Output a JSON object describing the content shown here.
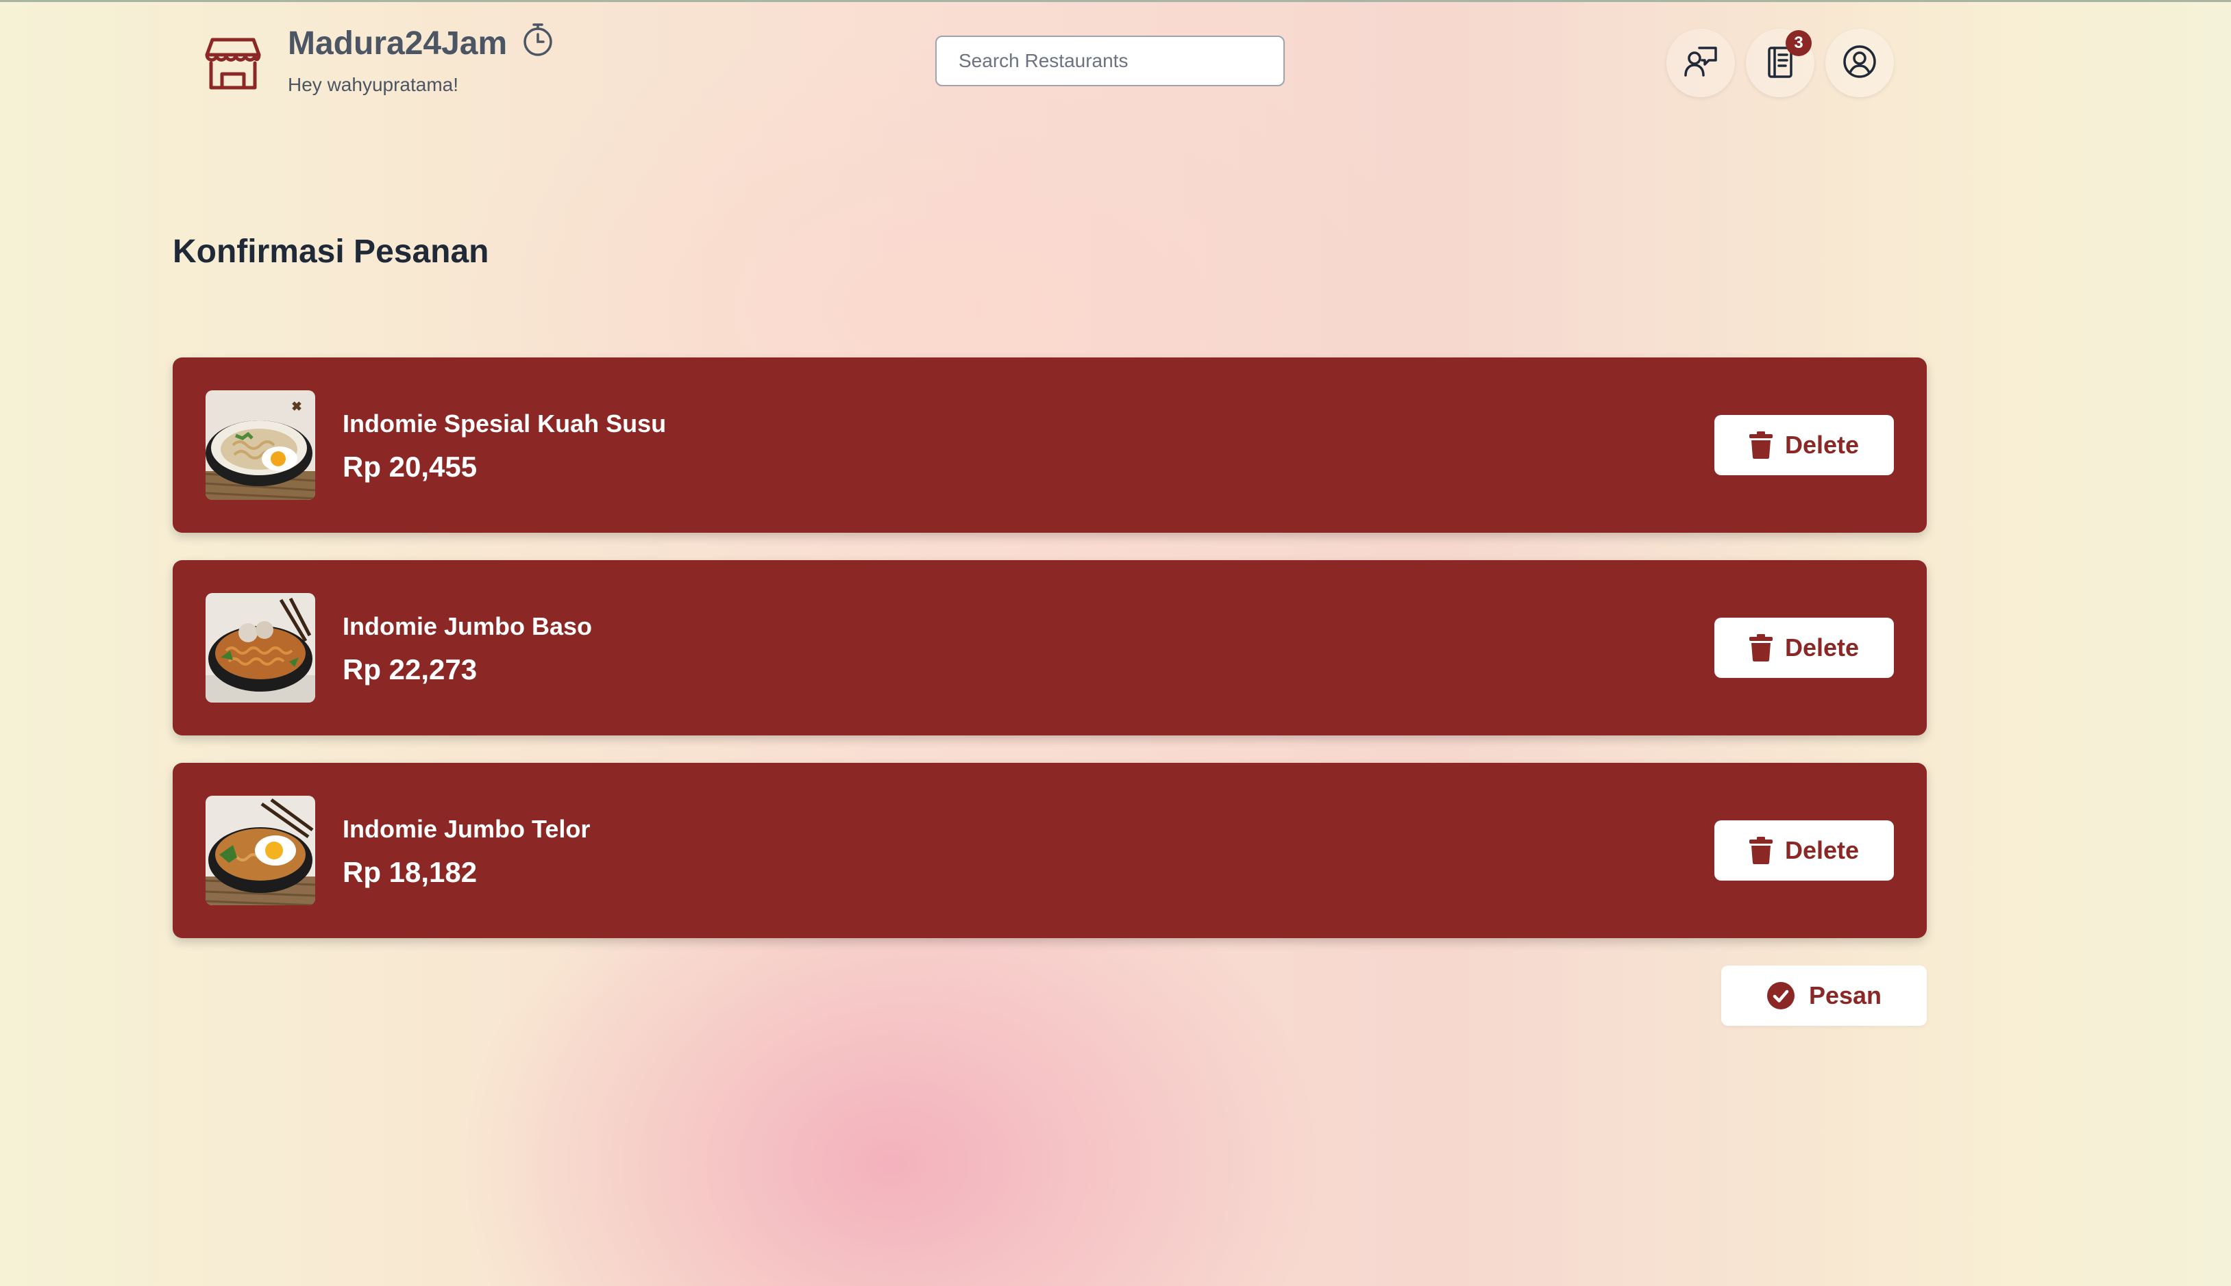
{
  "colors": {
    "accent": "#8b2724",
    "text": "#1f2937",
    "muted": "#4b5563",
    "card_text": "#ffffff"
  },
  "header": {
    "brand": "Madura24Jam",
    "greeting": "Hey wahyupratama!",
    "logo_icon": "store-icon",
    "clock_icon": "stopwatch-icon",
    "search": {
      "placeholder": "Search Restaurants",
      "value": ""
    },
    "actions": [
      {
        "icon": "chat-user-icon"
      },
      {
        "icon": "orders-icon",
        "badge": "3"
      },
      {
        "icon": "user-circle-icon"
      }
    ]
  },
  "main": {
    "title": "Konfirmasi Pesanan",
    "items": [
      {
        "name": "Indomie Spesial Kuah Susu",
        "price": "Rp 20,455",
        "image": "noodle-soup-egg",
        "delete_label": "Delete"
      },
      {
        "name": "Indomie Jumbo Baso",
        "price": "Rp 22,273",
        "image": "noodle-meatball",
        "delete_label": "Delete"
      },
      {
        "name": "Indomie Jumbo Telor",
        "price": "Rp 18,182",
        "image": "noodle-fried-egg",
        "delete_label": "Delete"
      }
    ],
    "order_button": {
      "label": "Pesan",
      "icon": "check-circle-icon"
    }
  }
}
